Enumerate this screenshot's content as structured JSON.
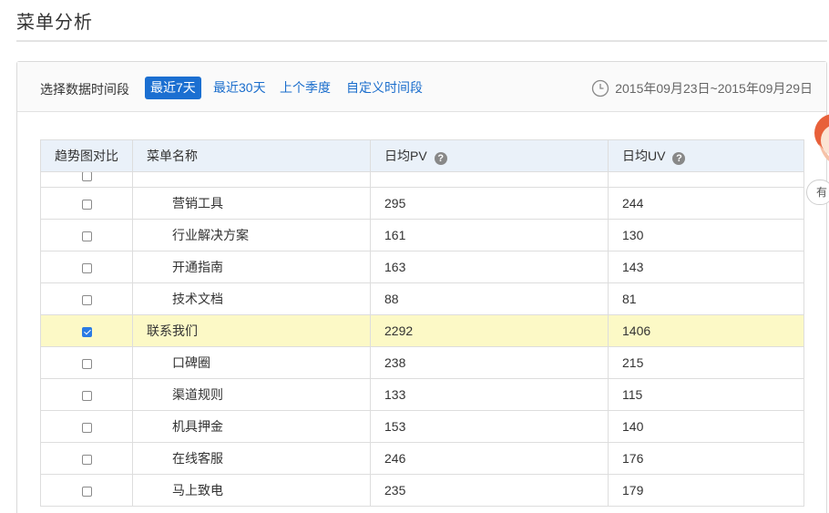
{
  "page": {
    "title": "菜单分析"
  },
  "filter": {
    "label": "选择数据时间段",
    "ranges": [
      "最近7天",
      "最近30天",
      "上个季度",
      "自定义时间段"
    ],
    "active_index": 0,
    "date_range": "2015年09月23日~2015年09月29日"
  },
  "table": {
    "headers": {
      "compare": "趋势图对比",
      "name": "菜单名称",
      "pv": "日均PV",
      "uv": "日均UV"
    },
    "rows": [
      {
        "name": "营销工具",
        "pv": "295",
        "uv": "244",
        "checked": false,
        "indent": true
      },
      {
        "name": "行业解决方案",
        "pv": "161",
        "uv": "130",
        "checked": false,
        "indent": true
      },
      {
        "name": "开通指南",
        "pv": "163",
        "uv": "143",
        "checked": false,
        "indent": true
      },
      {
        "name": "技术文档",
        "pv": "88",
        "uv": "81",
        "checked": false,
        "indent": true
      },
      {
        "name": "联系我们",
        "pv": "2292",
        "uv": "1406",
        "checked": true,
        "indent": false
      },
      {
        "name": "口碑圈",
        "pv": "238",
        "uv": "215",
        "checked": false,
        "indent": true
      },
      {
        "name": "渠道规则",
        "pv": "133",
        "uv": "115",
        "checked": false,
        "indent": true
      },
      {
        "name": "机具押金",
        "pv": "153",
        "uv": "140",
        "checked": false,
        "indent": true
      },
      {
        "name": "在线客服",
        "pv": "246",
        "uv": "176",
        "checked": false,
        "indent": true
      },
      {
        "name": "马上致电",
        "pv": "235",
        "uv": "179",
        "checked": false,
        "indent": true
      }
    ]
  },
  "side_widget": {
    "tab_label": "有"
  },
  "colors": {
    "accent": "#1b6fd1",
    "highlight_row": "#fcf9c6",
    "header_bg": "#eaf1f9"
  }
}
